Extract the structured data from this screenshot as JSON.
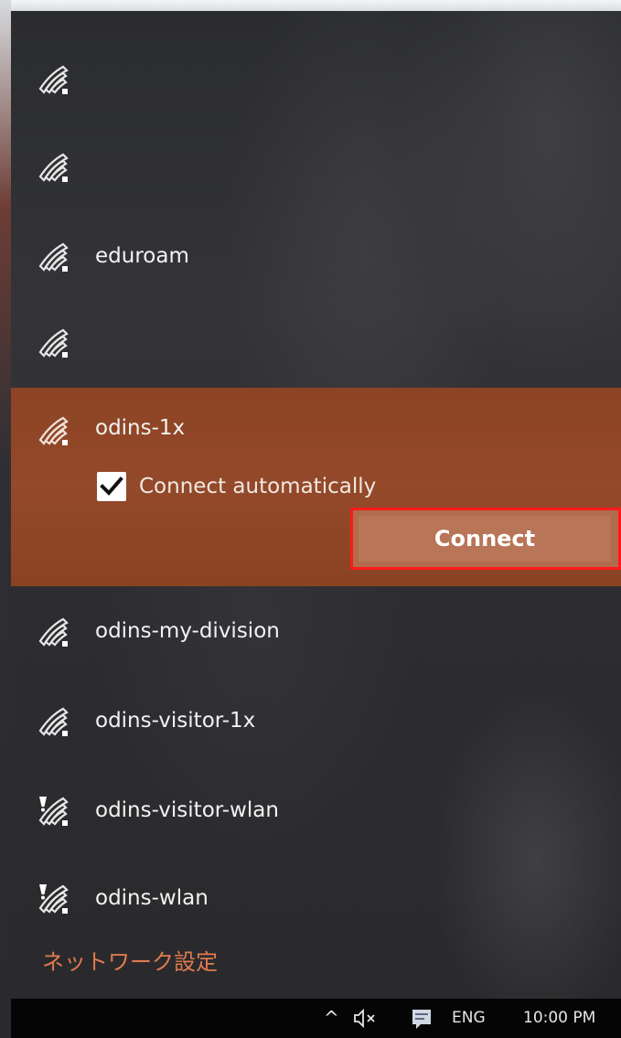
{
  "networks": [
    {
      "name": "",
      "secured": false
    },
    {
      "name": "",
      "secured": false
    },
    {
      "name": "eduroam",
      "secured": false
    },
    {
      "name": "",
      "secured": false
    },
    {
      "name": "odins-1x",
      "secured": false,
      "expanded": true
    },
    {
      "name": "odins-my-division",
      "secured": false
    },
    {
      "name": "odins-visitor-1x",
      "secured": false
    },
    {
      "name": "odins-visitor-wlan",
      "secured": true
    },
    {
      "name": "odins-wlan",
      "secured": true
    }
  ],
  "selected_network": {
    "connect_automatically_label": "Connect automatically",
    "connect_automatically_checked": true,
    "connect_button_label": "Connect"
  },
  "network_settings_link": "ネットワーク設定",
  "taskbar": {
    "chevron": "^",
    "volume_icon": "speaker-muted-icon",
    "action_center_icon": "action-center-icon",
    "language": "ENG",
    "time": "10:00 PM"
  },
  "colors": {
    "flyout_background": "#2d2d31",
    "selected_background": "#8d4424",
    "connect_button": "#b87558",
    "link": "#e07a4f",
    "highlight_box": "#ff1a1a"
  }
}
